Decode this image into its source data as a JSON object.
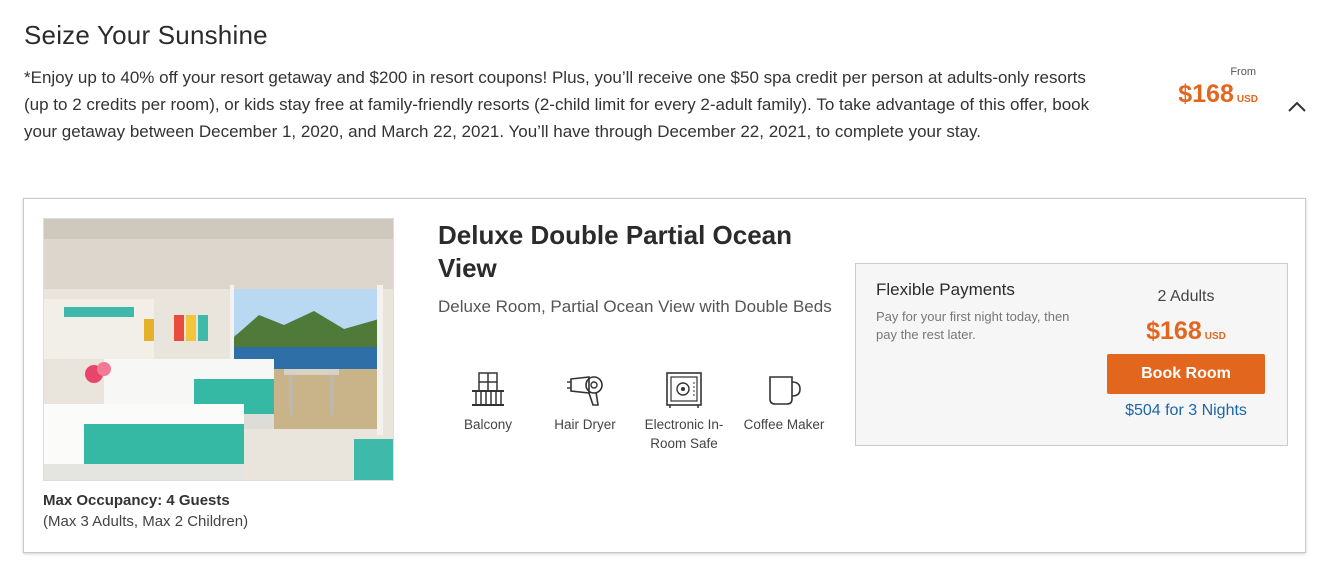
{
  "offer": {
    "title": "Seize Your Sunshine",
    "description": "*Enjoy up to 40% off your resort getaway and $200 in resort coupons! Plus, you’ll receive one $50 spa credit per person at adults-only resorts (up to 2 credits per room), or kids stay free at family-friendly resorts (2-child limit for every 2-adult family). To take advantage of this offer, book your getaway between December 1, 2020, and March 22, 2021. You’ll have through December 22, 2021, to complete your stay.",
    "from_label": "From",
    "from_price": "$168",
    "currency": "USD",
    "toggle_icon": "chevron-up-icon"
  },
  "room": {
    "name": "Deluxe Double Partial Ocean View",
    "subtitle": "Deluxe Room, Partial Ocean View with Double Beds",
    "image": "room-photo-ocean-view",
    "max_occupancy": "Max Occupancy: 4 Guests",
    "occupancy_detail": "(Max 3 Adults, Max 2 Children)",
    "amenities": [
      {
        "label": "Balcony",
        "icon": "balcony-icon"
      },
      {
        "label": "Hair Dryer",
        "icon": "hair-dryer-icon"
      },
      {
        "label": "Electronic In-Room Safe",
        "icon": "safe-icon"
      },
      {
        "label": "Coffee Maker",
        "icon": "coffee-maker-icon"
      }
    ]
  },
  "payment": {
    "title": "Flexible Payments",
    "description": "Pay for your first night today, then pay the rest later.",
    "guests": "2 Adults",
    "price": "$168",
    "currency": "USD",
    "book_label": "Book Room",
    "total_label": "$504 for 3 Nights"
  },
  "colors": {
    "accent": "#e2661e",
    "link": "#1a66a8",
    "box_bg": "#f6f6f6"
  }
}
